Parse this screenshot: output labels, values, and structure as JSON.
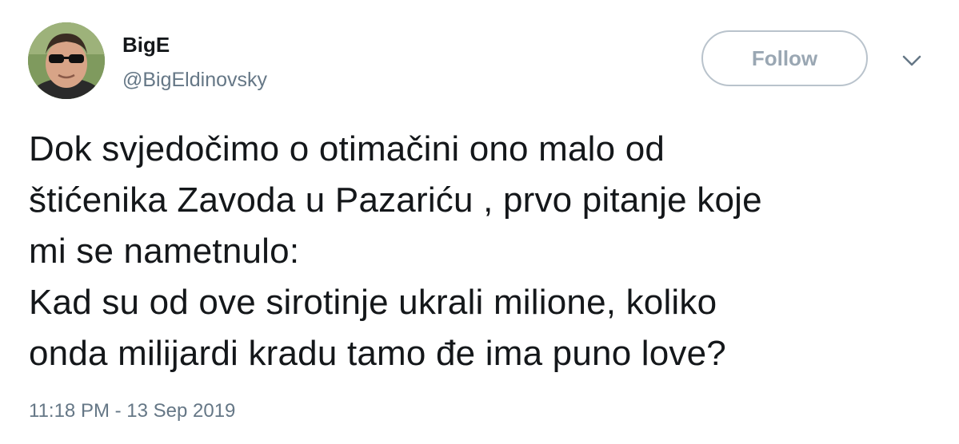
{
  "author": {
    "name": "BigE",
    "handle": "@BigEldinovsky"
  },
  "header": {
    "follow_label": "Follow",
    "more_icon": "chevron-down-icon"
  },
  "tweet": {
    "lines": [
      "Dok svjedočimo o otimačini ono malo od",
      "štićenika Zavoda u Pazariću , prvo pitanje koje",
      "mi se nametnulo:",
      "Kad su od ove sirotinje ukrali milione, koliko",
      "onda milijardi kradu tamo đe ima puno love?"
    ],
    "timestamp": "11:18 PM - 13 Sep 2019"
  },
  "colors": {
    "text": "#14171a",
    "secondary": "#657786",
    "follow_border": "#b9c3cc",
    "follow_text": "#9aa7b3"
  }
}
